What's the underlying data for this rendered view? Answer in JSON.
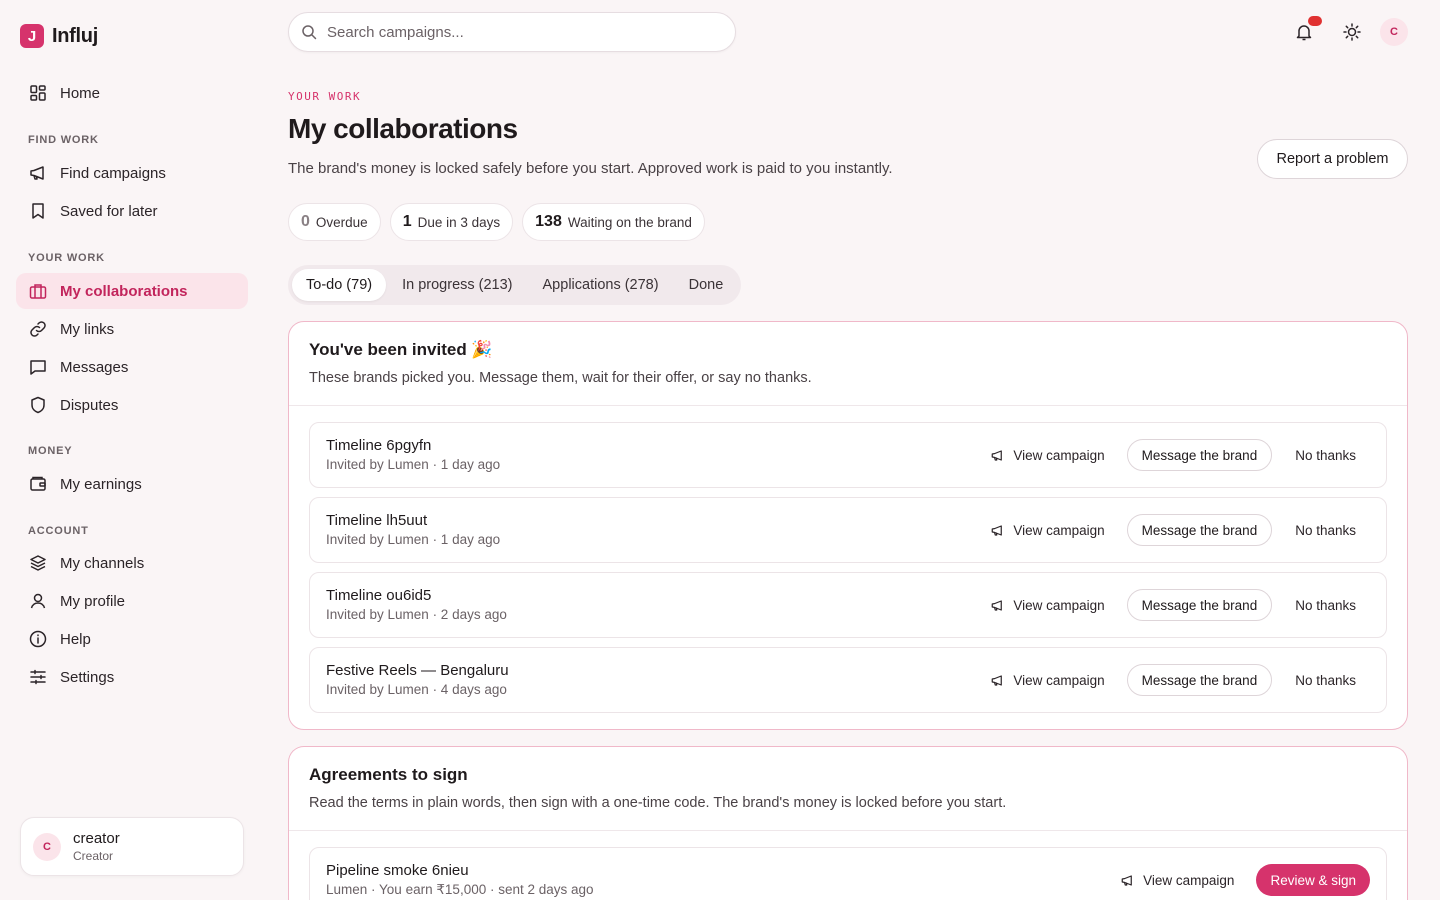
{
  "brand": {
    "logo_letter": "J",
    "name": "Influj"
  },
  "sidebar": {
    "home": "Home",
    "sections": {
      "find_work": "FIND WORK",
      "your_work": "YOUR WORK",
      "money": "MONEY",
      "account": "ACCOUNT"
    },
    "items": {
      "find_campaigns": "Find campaigns",
      "saved_for_later": "Saved for later",
      "my_collaborations": "My collaborations",
      "my_links": "My links",
      "messages": "Messages",
      "disputes": "Disputes",
      "my_earnings": "My earnings",
      "my_channels": "My channels",
      "my_profile": "My profile",
      "help": "Help",
      "settings": "Settings"
    },
    "active": "my_collaborations",
    "user": {
      "initial": "C",
      "name": "creator",
      "role": "Creator"
    }
  },
  "topbar": {
    "search_placeholder": "Search campaigns...",
    "avatar_initial": "C",
    "notification_color": "#e03131"
  },
  "header": {
    "eyebrow": "YOUR WORK",
    "title": "My collaborations",
    "subtitle": "The brand's money is locked safely before you start. Approved work is paid to you instantly.",
    "report_button": "Report a problem"
  },
  "stats": [
    {
      "value": "0",
      "label": "Overdue"
    },
    {
      "value": "1",
      "label": "Due in 3 days"
    },
    {
      "value": "138",
      "label": "Waiting on the brand"
    }
  ],
  "tabs": [
    {
      "label": "To-do (79)",
      "active": true
    },
    {
      "label": "In progress (213)",
      "active": false
    },
    {
      "label": "Applications (278)",
      "active": false
    },
    {
      "label": "Done",
      "active": false
    }
  ],
  "invited": {
    "title": "You've been invited 🎉",
    "subtitle": "These brands picked you. Message them, wait for their offer, or say no thanks.",
    "view_label": "View campaign",
    "message_label": "Message the brand",
    "decline_label": "No thanks",
    "rows": [
      {
        "title": "Timeline 6pgyfn",
        "meta": "Invited by Lumen · 1 day ago"
      },
      {
        "title": "Timeline lh5uut",
        "meta": "Invited by Lumen · 1 day ago"
      },
      {
        "title": "Timeline ou6id5",
        "meta": "Invited by Lumen · 2 days ago"
      },
      {
        "title": "Festive Reels — Bengaluru",
        "meta": "Invited by Lumen · 4 days ago"
      }
    ]
  },
  "agreements": {
    "title": "Agreements to sign",
    "subtitle": "Read the terms in plain words, then sign with a one-time code. The brand's money is locked before you start.",
    "view_label": "View campaign",
    "sign_label": "Review & sign",
    "rows": [
      {
        "title": "Pipeline smoke 6nieu",
        "meta": "Lumen · You earn ₹15,000 · sent 2 days ago"
      }
    ]
  },
  "colors": {
    "accent": "#d6336c",
    "accent_soft": "#fbe4ea",
    "background": "#faf5f6"
  }
}
